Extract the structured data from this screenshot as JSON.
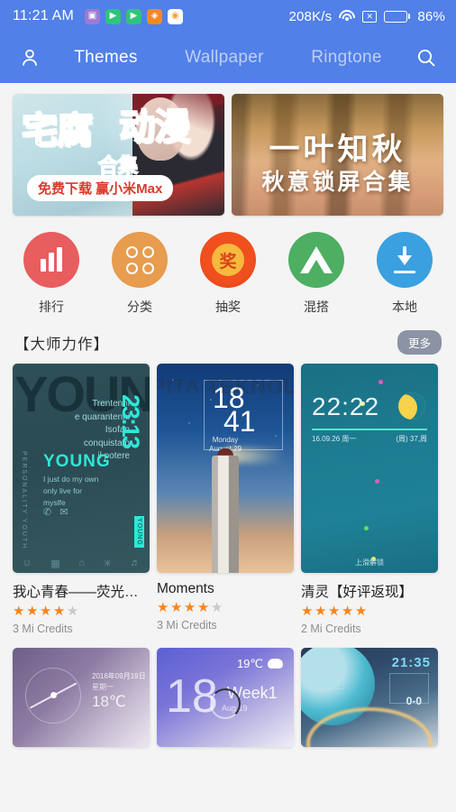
{
  "statusbar": {
    "time": "11:21 AM",
    "app_icons": [
      "purple-app-icon",
      "play-store-icon",
      "play-icon",
      "orange-app-icon",
      "camera-app-icon"
    ],
    "network_speed": "208K/s",
    "wifi_icon": "wifi-icon",
    "sim_icon": "no-sim-icon",
    "sim_glyph": "✕",
    "battery_percent": "86%",
    "battery_level": 86
  },
  "navbar": {
    "profile_icon": "person-icon",
    "search_icon": "search-icon",
    "tabs": [
      {
        "label": "Themes",
        "active": true
      },
      {
        "label": "Wallpaper",
        "active": false
      },
      {
        "label": "Ringtone",
        "active": false
      }
    ]
  },
  "banners": [
    {
      "title": "宅腐",
      "title2": "动漫",
      "sub_small": "合集",
      "cta": "免费下载 赢小米Max"
    },
    {
      "title": "一叶知秋",
      "subtitle": "秋意锁屏合集"
    }
  ],
  "quick_actions": [
    {
      "label": "排行",
      "icon": "bar-chart-icon",
      "color": "#e85d5d"
    },
    {
      "label": "分类",
      "icon": "four-circles-icon",
      "color": "#e79c4e"
    },
    {
      "label": "抽奖",
      "icon": "prize-icon",
      "glyph": "奖",
      "color": "#f0501e"
    },
    {
      "label": "混搭",
      "icon": "triangle-icon",
      "color": "#4caf62"
    },
    {
      "label": "本地",
      "icon": "download-icon",
      "color": "#3aa0e0"
    }
  ],
  "section": {
    "title": "【大师力作】",
    "more_label": "更多"
  },
  "themes_row1": [
    {
      "name": "我心青春——荧光…",
      "rating": 4.5,
      "credits": "3 Mi Credits",
      "preview": {
        "big_word": "YOUN",
        "italian": "Trentenni\ne quarantenni\nIsofan\nconquistato\nil potere",
        "time": "23:13",
        "brand": "YOUNG",
        "small": "I just do my own\nonly live for\nmyslfe",
        "side_text": "PERSONALITY YOUTH",
        "tag": "YOUNG"
      }
    },
    {
      "name": "Moments",
      "rating": 4.5,
      "credits": "3 Mi Credits",
      "preview": {
        "hour": "18",
        "minute": "41",
        "weekday": "Monday",
        "date": "August 29",
        "watermark": "PITA TEKNOLOGI"
      }
    },
    {
      "name": "清灵【好评返现】",
      "rating": 5,
      "credits": "2 Mi Credits",
      "preview": {
        "time": "22:22",
        "date_left": "16.09.26  周一",
        "date_right": "(周) 37,周",
        "footer": "上滑解锁",
        "moon_icon": "moon-icon"
      }
    }
  ],
  "themes_row2": [
    {
      "preview": {
        "date": "2016年09月19日",
        "weekday": "星期一",
        "temp": "18℃"
      }
    },
    {
      "preview": {
        "temp": "19℃",
        "weather_icon": "cloud-icon",
        "number": "18",
        "week": "Week1",
        "sub": "Aug 19",
        "loading": "loading-spinner"
      }
    },
    {
      "preview": {
        "time": "21:35",
        "score": "0-0"
      }
    }
  ],
  "colors": {
    "header_blue": "#5180e8",
    "page_background": "#f4f4f4",
    "star_on": "#f5861f",
    "star_off": "#c9c9c9",
    "more_pill": "#8b93a4"
  }
}
